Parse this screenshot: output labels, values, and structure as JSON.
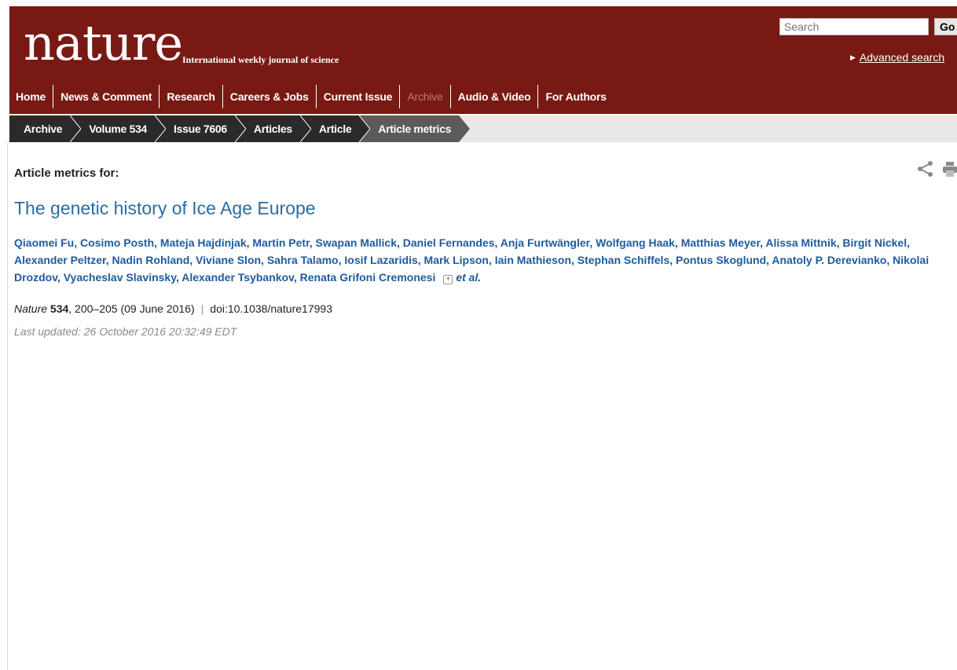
{
  "header": {
    "logo_text": "nature",
    "tagline": "International weekly journal of science",
    "search_placeholder": "Search",
    "go_label": "Go",
    "advanced_search": "Advanced search"
  },
  "nav": {
    "items": [
      "Home",
      "News & Comment",
      "Research",
      "Careers & Jobs",
      "Current Issue",
      "Archive",
      "Audio & Video",
      "For Authors"
    ],
    "active": "Archive"
  },
  "breadcrumb": {
    "items": [
      "Archive",
      "Volume 534",
      "Issue 7606",
      "Articles",
      "Article",
      "Article metrics"
    ]
  },
  "article": {
    "metrics_heading": "Article metrics for:",
    "title": "The genetic history of Ice Age Europe",
    "authors": "Qiaomei Fu, Cosimo Posth, Mateja Hajdinjak, Martin Petr, Swapan Mallick, Daniel Fernandes, Anja Furtwängler, Wolfgang Haak, Matthias Meyer, Alissa Mittnik, Birgit Nickel, Alexander Peltzer, Nadin Rohland, Viviane Slon, Sahra Talamo, Iosif Lazaridis, Mark Lipson, Iain Mathieson, Stephan Schiffels, Pontus Skoglund, Anatoly P. Derevianko, Nikolai Drozdov, Vyacheslav Slavinsky, Alexander Tsybankov, Renata Grifoni Cremonesi",
    "et_al": "et al.",
    "journal": "Nature",
    "volume": "534",
    "pages_date": ", 200–205 (09 June 2016)",
    "doi": "doi:10.1038/nature17993",
    "last_updated": "Last updated: 26 October 2016 20:32:49 EDT"
  },
  "icons": [
    "share-icon",
    "print-icon",
    "plus-icon"
  ],
  "colors": {
    "masthead": "#791913",
    "link": "#1f5b9c",
    "title": "#2b6da1",
    "crumb": "#2a2a2a",
    "crumb_active": "#5b5b5b"
  }
}
